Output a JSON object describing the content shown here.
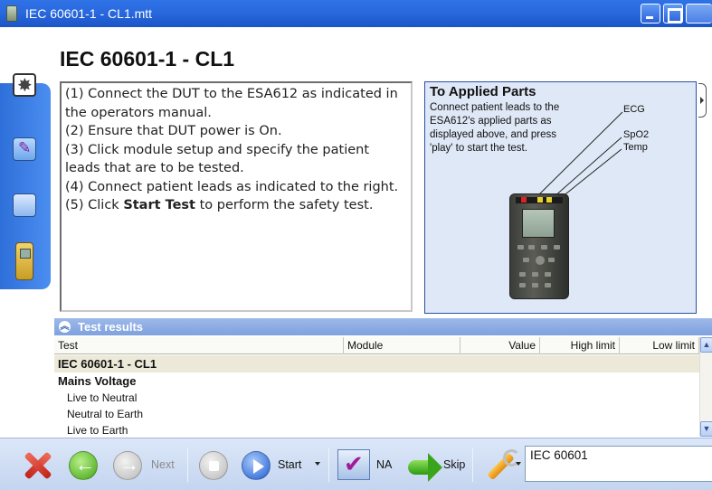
{
  "window": {
    "title": "IEC 60601-1 - CL1.mtt"
  },
  "heading": "IEC 60601-1 - CL1",
  "instructions": {
    "step1": "(1) Connect the DUT to the ESA612 as indicated in the operators manual.",
    "step2": "(2) Ensure that DUT power is On.",
    "step3": "(3) Click module setup and specify the patient leads that are to be tested.",
    "step4": "(4) Connect patient leads as indicated to the right.",
    "step5_prefix": "(5) Click ",
    "step5_bold": "Start Test",
    "step5_suffix": " to perform the safety test."
  },
  "applied_parts": {
    "title": "To Applied Parts",
    "description": "Connect patient leads to the ESA612's applied parts as displayed above, and press 'play' to start the test.",
    "leads": [
      "ECG",
      "SpO2",
      "Temp"
    ]
  },
  "results": {
    "header": "Test results",
    "columns": {
      "test": "Test",
      "module": "Module",
      "value": "Value",
      "high_limit": "High limit",
      "low_limit": "Low limit"
    },
    "group": "IEC 60601-1 - CL1",
    "subgroup": "Mains Voltage",
    "items": [
      "Live to Neutral",
      "Neutral to Earth",
      "Live to Earth"
    ]
  },
  "toolbar": {
    "next_label": "Next",
    "start_label": "Start",
    "na_label": "NA",
    "skip_label": "Skip",
    "profile_value": "IEC 60601"
  },
  "icons": {
    "abort": "close-x-icon",
    "back": "back-arrow-icon",
    "next": "next-arrow-icon",
    "stop": "stop-icon",
    "start": "play-icon",
    "na": "checkmark-icon",
    "skip": "skip-arrow-icon",
    "settings": "wrench-icon"
  },
  "colors": {
    "titlebar": "#2a6ae0",
    "tab_strip": "#2e6fd9",
    "results_header": "#8aabe2",
    "toolbar": "#d2dff4"
  }
}
